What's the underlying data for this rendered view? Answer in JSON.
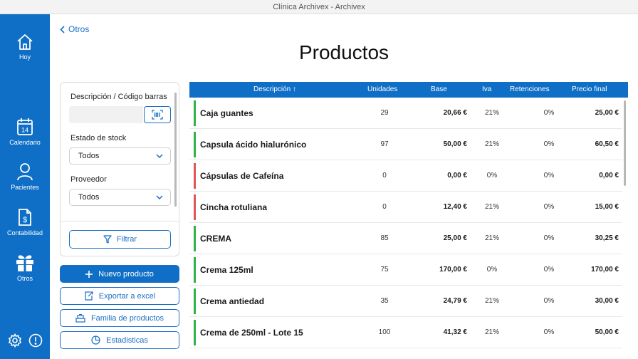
{
  "window": {
    "title": "Clínica Archivex - Archivex"
  },
  "sidebar": {
    "items": [
      {
        "label": "Hoy",
        "icon": "home-icon"
      },
      {
        "label": "Calendario",
        "icon": "calendar-icon",
        "day": "14"
      },
      {
        "label": "Pacientes",
        "icon": "user-icon"
      },
      {
        "label": "Contabilidad",
        "icon": "invoice-icon"
      },
      {
        "label": "Otros",
        "icon": "gift-icon"
      }
    ],
    "bottom": [
      "gear-icon",
      "alert-icon"
    ]
  },
  "back": {
    "label": "Otros"
  },
  "page": {
    "title": "Productos"
  },
  "filters": {
    "search_label": "Descripción / Código barras",
    "search_value": "",
    "stock_label": "Estado de stock",
    "stock_value": "Todos",
    "supplier_label": "Proveedor",
    "supplier_value": "Todos",
    "filter_button": "Filtrar"
  },
  "actions": {
    "new_product": "Nuevo producto",
    "export_excel": "Exportar a excel",
    "product_family": "Familia de productos",
    "statistics": "Estadisticas"
  },
  "colors": {
    "accent": "#0f6fc6",
    "in_stock": "#2db34a",
    "out_of_stock": "#e05555"
  },
  "table": {
    "columns": {
      "description": "Descripción ↑",
      "units": "Unidades",
      "base": "Base",
      "iva": "Iva",
      "retentions": "Retenciones",
      "final_price": "Precio final"
    },
    "rows": [
      {
        "description": "Caja guantes",
        "units": "29",
        "base": "20,66 €",
        "iva": "21%",
        "retentions": "0%",
        "final_price": "25,00 €",
        "status": "in_stock"
      },
      {
        "description": "Capsula ácido hialurónico",
        "units": "97",
        "base": "50,00 €",
        "iva": "21%",
        "retentions": "0%",
        "final_price": "60,50 €",
        "status": "in_stock"
      },
      {
        "description": "Cápsulas de Cafeína",
        "units": "0",
        "base": "0,00 €",
        "iva": "0%",
        "retentions": "0%",
        "final_price": "0,00 €",
        "status": "out_of_stock"
      },
      {
        "description": "Cincha rotuliana",
        "units": "0",
        "base": "12,40 €",
        "iva": "21%",
        "retentions": "0%",
        "final_price": "15,00 €",
        "status": "out_of_stock"
      },
      {
        "description": "CREMA",
        "units": "85",
        "base": "25,00 €",
        "iva": "21%",
        "retentions": "0%",
        "final_price": "30,25 €",
        "status": "in_stock"
      },
      {
        "description": "Crema 125ml",
        "units": "75",
        "base": "170,00 €",
        "iva": "0%",
        "retentions": "0%",
        "final_price": "170,00 €",
        "status": "in_stock"
      },
      {
        "description": "Crema antiedad",
        "units": "35",
        "base": "24,79 €",
        "iva": "21%",
        "retentions": "0%",
        "final_price": "30,00 €",
        "status": "in_stock"
      },
      {
        "description": "Crema de 250ml - Lote 15",
        "units": "100",
        "base": "41,32 €",
        "iva": "21%",
        "retentions": "0%",
        "final_price": "50,00 €",
        "status": "in_stock"
      }
    ]
  }
}
